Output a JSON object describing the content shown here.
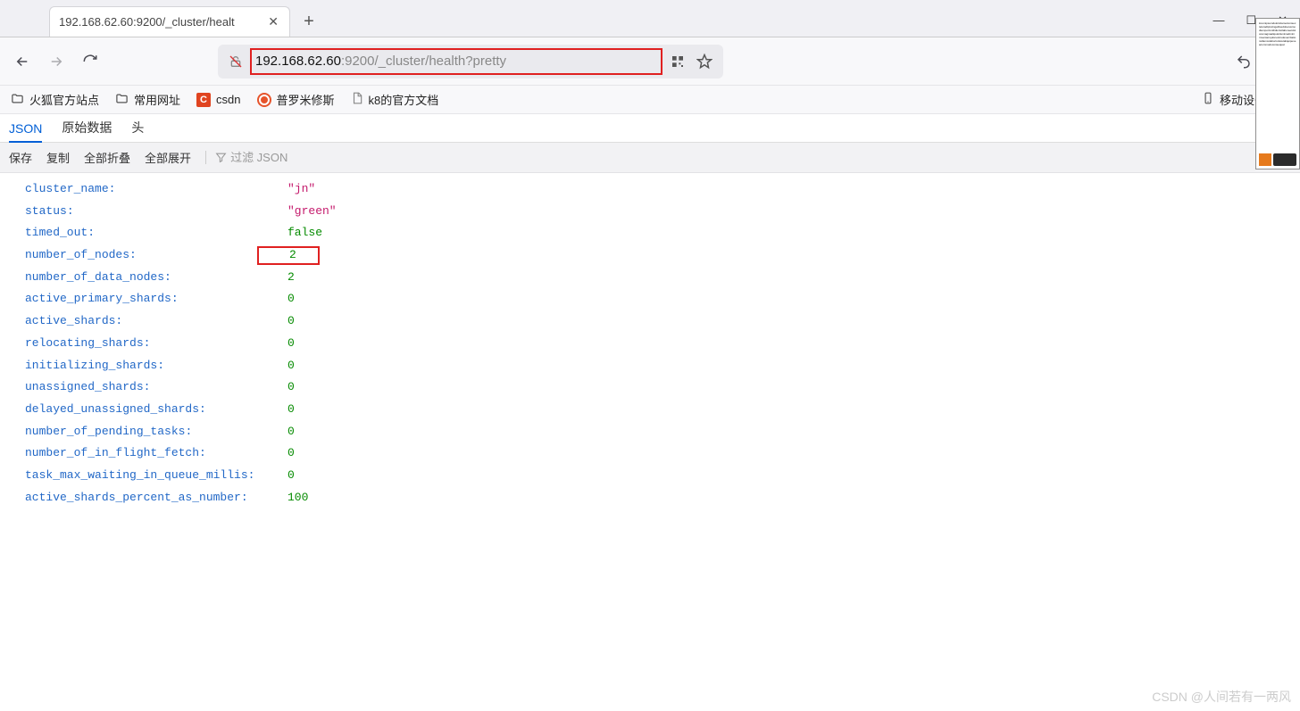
{
  "tab": {
    "title": "192.168.62.60:9200/_cluster/healt"
  },
  "url": {
    "host": "192.168.62.60",
    "rest": ":9200/_cluster/health?pretty"
  },
  "bookmarks": {
    "b1": "火狐官方站点",
    "b2": "常用网址",
    "b3": "csdn",
    "b4": "普罗米修斯",
    "b5": "k8的官方文档",
    "right": "移动设备上的"
  },
  "viewTabs": {
    "json": "JSON",
    "raw": "原始数据",
    "headers": "头"
  },
  "actions": {
    "save": "保存",
    "copy": "复制",
    "collapse": "全部折叠",
    "expand": "全部展开",
    "filterPlaceholder": "过滤 JSON"
  },
  "json": {
    "cluster_name": {
      "k": "cluster_name",
      "v": "\"jn\""
    },
    "status": {
      "k": "status",
      "v": "\"green\""
    },
    "timed_out": {
      "k": "timed_out",
      "v": "false"
    },
    "number_of_nodes": {
      "k": "number_of_nodes",
      "v": "2"
    },
    "number_of_data_nodes": {
      "k": "number_of_data_nodes",
      "v": "2"
    },
    "active_primary_shards": {
      "k": "active_primary_shards",
      "v": "0"
    },
    "active_shards": {
      "k": "active_shards",
      "v": "0"
    },
    "relocating_shards": {
      "k": "relocating_shards",
      "v": "0"
    },
    "initializing_shards": {
      "k": "initializing_shards",
      "v": "0"
    },
    "unassigned_shards": {
      "k": "unassigned_shards",
      "v": "0"
    },
    "delayed_unassigned_shards": {
      "k": "delayed_unassigned_shards",
      "v": "0"
    },
    "number_of_pending_tasks": {
      "k": "number_of_pending_tasks",
      "v": "0"
    },
    "number_of_in_flight_fetch": {
      "k": "number_of_in_flight_fetch",
      "v": "0"
    },
    "task_max_waiting_in_queue_millis": {
      "k": "task_max_waiting_in_queue_millis",
      "v": "0"
    },
    "active_shards_percent_as_number": {
      "k": "active_shards_percent_as_number",
      "v": "100"
    }
  },
  "watermark": "CSDN @人间若有一两风",
  "win": {
    "min": "—",
    "max": "☐",
    "close": "✕"
  }
}
